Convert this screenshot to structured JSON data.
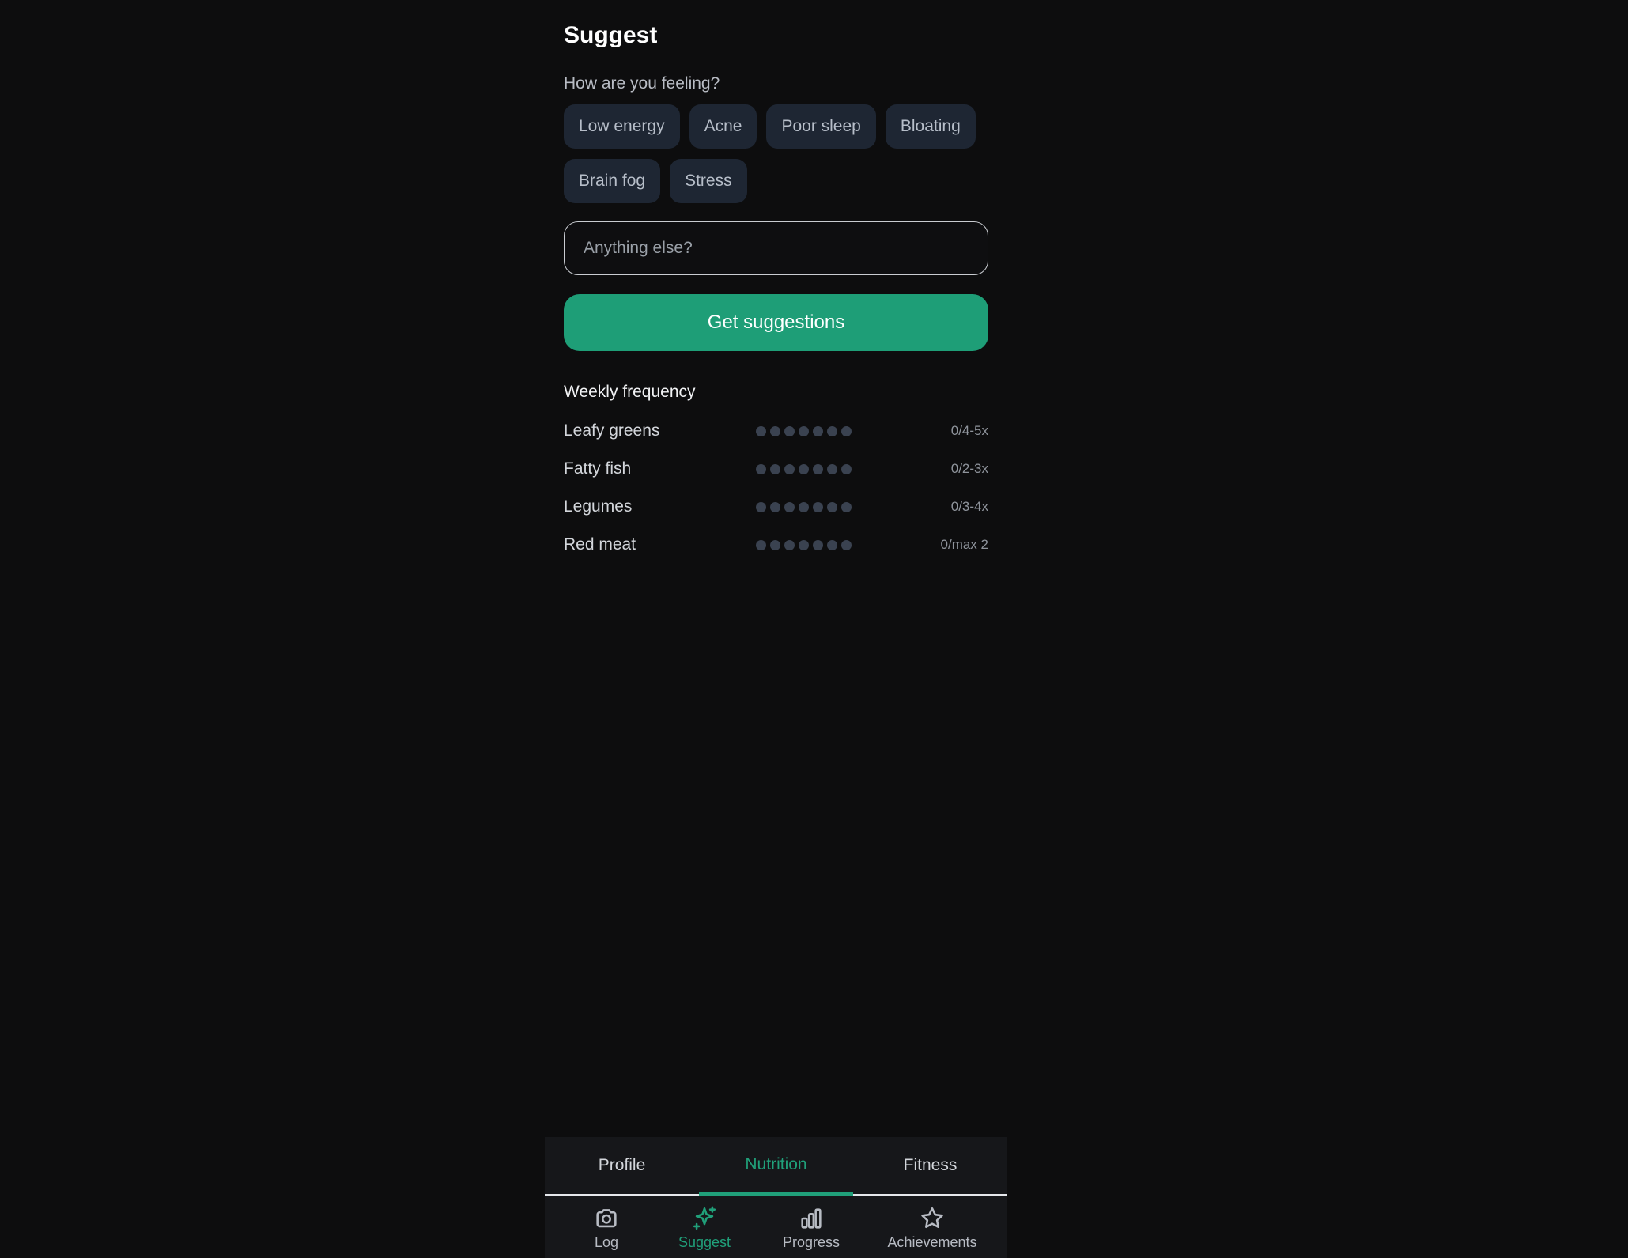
{
  "header": {
    "title": "Suggest"
  },
  "feeling": {
    "prompt": "How are you feeling?",
    "chips": [
      "Low energy",
      "Acne",
      "Poor sleep",
      "Bloating",
      "Brain fog",
      "Stress"
    ]
  },
  "input": {
    "placeholder": "Anything else?",
    "value": ""
  },
  "primary_button": {
    "label": "Get suggestions"
  },
  "weekly": {
    "title": "Weekly frequency",
    "rows": [
      {
        "name": "Leafy greens",
        "value": "0/4-5x",
        "filled": 0,
        "total": 7
      },
      {
        "name": "Fatty fish",
        "value": "0/2-3x",
        "filled": 0,
        "total": 7
      },
      {
        "name": "Legumes",
        "value": "0/3-4x",
        "filled": 0,
        "total": 7
      },
      {
        "name": "Red meat",
        "value": "0/max 2",
        "filled": 0,
        "total": 7
      }
    ]
  },
  "top_tabs": [
    {
      "label": "Profile",
      "active": false
    },
    {
      "label": "Nutrition",
      "active": true
    },
    {
      "label": "Fitness",
      "active": false
    }
  ],
  "bottom_nav": [
    {
      "label": "Log",
      "icon": "camera-icon",
      "active": false
    },
    {
      "label": "Suggest",
      "icon": "sparkles-icon",
      "active": true
    },
    {
      "label": "Progress",
      "icon": "bar-chart-icon",
      "active": false
    },
    {
      "label": "Achievements",
      "icon": "star-icon",
      "active": false
    }
  ],
  "colors": {
    "accent": "#1e9e77",
    "chip_bg": "#1e2633",
    "dot_empty": "#3a4250",
    "background": "#0d0d0e"
  }
}
